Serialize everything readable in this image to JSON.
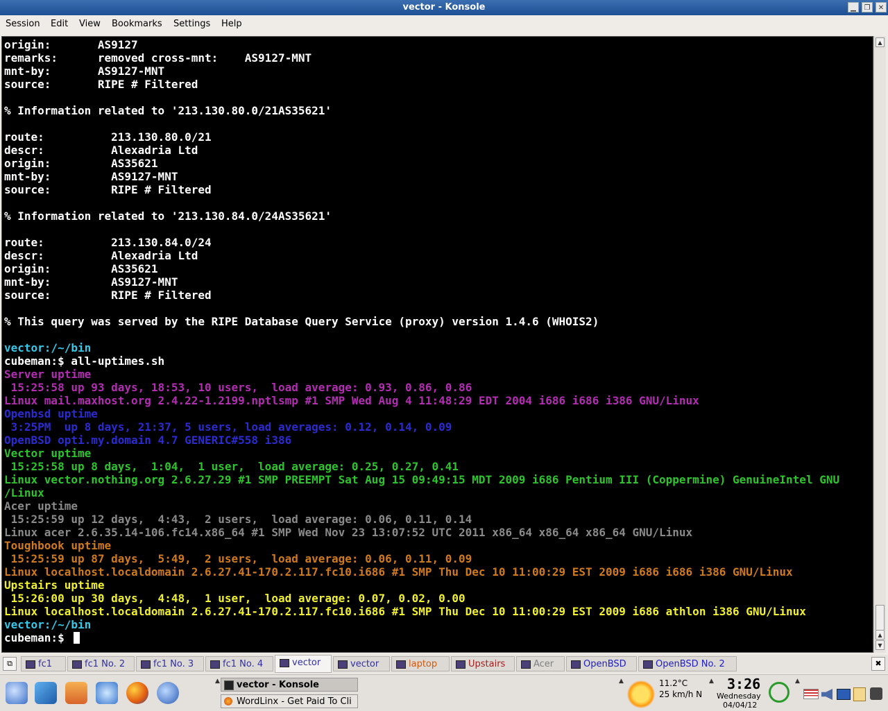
{
  "window": {
    "title": "vector - Konsole"
  },
  "menu": [
    "Session",
    "Edit",
    "View",
    "Bookmarks",
    "Settings",
    "Help"
  ],
  "terminal_lines": [
    {
      "text": "origin:       AS9127",
      "color": "#ffffff"
    },
    {
      "text": "remarks:      removed cross-mnt:    AS9127-MNT",
      "color": "#ffffff"
    },
    {
      "text": "mnt-by:       AS9127-MNT",
      "color": "#ffffff"
    },
    {
      "text": "source:       RIPE # Filtered",
      "color": "#ffffff"
    },
    {
      "text": "",
      "color": "#ffffff"
    },
    {
      "text": "% Information related to '213.130.80.0/21AS35621'",
      "color": "#ffffff"
    },
    {
      "text": "",
      "color": "#ffffff"
    },
    {
      "text": "route:          213.130.80.0/21",
      "color": "#ffffff"
    },
    {
      "text": "descr:          Alexadria Ltd",
      "color": "#ffffff"
    },
    {
      "text": "origin:         AS35621",
      "color": "#ffffff"
    },
    {
      "text": "mnt-by:         AS9127-MNT",
      "color": "#ffffff"
    },
    {
      "text": "source:         RIPE # Filtered",
      "color": "#ffffff"
    },
    {
      "text": "",
      "color": "#ffffff"
    },
    {
      "text": "% Information related to '213.130.84.0/24AS35621'",
      "color": "#ffffff"
    },
    {
      "text": "",
      "color": "#ffffff"
    },
    {
      "text": "route:          213.130.84.0/24",
      "color": "#ffffff"
    },
    {
      "text": "descr:          Alexadria Ltd",
      "color": "#ffffff"
    },
    {
      "text": "origin:         AS35621",
      "color": "#ffffff"
    },
    {
      "text": "mnt-by:         AS9127-MNT",
      "color": "#ffffff"
    },
    {
      "text": "source:         RIPE # Filtered",
      "color": "#ffffff"
    },
    {
      "text": "",
      "color": "#ffffff"
    },
    {
      "text": "% This query was served by the RIPE Database Query Service (proxy) version 1.4.6 (WHOIS2)",
      "color": "#ffffff"
    },
    {
      "text": "",
      "color": "#ffffff"
    },
    {
      "text": "vector:/~/bin",
      "color": "#37c8e8"
    },
    {
      "text": "cubeman:$ all-uptimes.sh",
      "color": "#ffffff"
    },
    {
      "text": "Server uptime",
      "color": "#b22db2"
    },
    {
      "text": " 15:25:58 up 93 days, 18:53, 10 users,  load average: 0.93, 0.86, 0.86",
      "color": "#b22db2"
    },
    {
      "text": "Linux mail.maxhost.org 2.4.22-1.2199.nptlsmp #1 SMP Wed Aug 4 11:48:29 EDT 2004 i686 i686 i386 GNU/Linux",
      "color": "#b22db2"
    },
    {
      "text": "Openbsd uptime",
      "color": "#2b2bd0"
    },
    {
      "text": " 3:25PM  up 8 days, 21:37, 5 users, load averages: 0.12, 0.14, 0.09",
      "color": "#2b2bd0"
    },
    {
      "text": "OpenBSD opti.my.domain 4.7 GENERIC#558 i386",
      "color": "#2b2bd0"
    },
    {
      "text": "Vector uptime",
      "color": "#2ec42e"
    },
    {
      "text": " 15:25:58 up 8 days,  1:04,  1 user,  load average: 0.25, 0.27, 0.41",
      "color": "#2ec42e"
    },
    {
      "text": "Linux vector.nothing.org 2.6.27.29 #1 SMP PREEMPT Sat Aug 15 09:49:15 MDT 2009 i686 Pentium III (Coppermine) GenuineIntel GNU",
      "color": "#2ec42e"
    },
    {
      "text": "/Linux",
      "color": "#2ec42e"
    },
    {
      "text": "Acer uptime",
      "color": "#8a8a8a"
    },
    {
      "text": " 15:25:59 up 12 days,  4:43,  2 users,  load average: 0.06, 0.11, 0.14",
      "color": "#8a8a8a"
    },
    {
      "text": "Linux acer 2.6.35.14-106.fc14.x86_64 #1 SMP Wed Nov 23 13:07:52 UTC 2011 x86_64 x86_64 x86_64 GNU/Linux",
      "color": "#8a8a8a"
    },
    {
      "text": "Toughbook uptime",
      "color": "#d07a1e"
    },
    {
      "text": " 15:25:59 up 87 days,  5:49,  2 users,  load average: 0.06, 0.11, 0.09",
      "color": "#d07a1e"
    },
    {
      "text": "Linux localhost.localdomain 2.6.27.41-170.2.117.fc10.i686 #1 SMP Thu Dec 10 11:00:29 EST 2009 i686 i686 i386 GNU/Linux",
      "color": "#d07a1e"
    },
    {
      "text": "Upstairs uptime",
      "color": "#f0f030"
    },
    {
      "text": " 15:26:00 up 30 days,  4:48,  1 user,  load average: 0.07, 0.02, 0.00",
      "color": "#f0f030"
    },
    {
      "text": "Linux localhost.localdomain 2.6.27.41-170.2.117.fc10.i686 #1 SMP Thu Dec 10 11:00:29 EST 2009 i686 athlon i386 GNU/Linux",
      "color": "#f0f030"
    },
    {
      "text": "vector:/~/bin",
      "color": "#37c8e8"
    },
    {
      "text": "cubeman:$ ",
      "color": "#ffffff"
    }
  ],
  "tabs": [
    {
      "label": "fc1",
      "color": "#3030a0"
    },
    {
      "label": "fc1 No. 2",
      "color": "#3030a0"
    },
    {
      "label": "fc1 No. 3",
      "color": "#3030a0"
    },
    {
      "label": "fc1 No. 4",
      "color": "#3030a0"
    },
    {
      "label": "vector",
      "color": "#3030a0"
    },
    {
      "label": "vector",
      "color": "#3030a0"
    },
    {
      "label": "laptop",
      "color": "#d05a10"
    },
    {
      "label": "Upstairs",
      "color": "#a02020"
    },
    {
      "label": "Acer",
      "color": "#808080"
    },
    {
      "label": "OpenBSD",
      "color": "#2020c0"
    },
    {
      "label": "OpenBSD No. 2",
      "color": "#2020c0"
    }
  ],
  "taskbar": {
    "tasks": [
      "vector - Konsole",
      "WordLinx - Get Paid To Cli"
    ],
    "weather": {
      "temp": "11.2°C",
      "wind": "25 km/h N"
    },
    "clock": {
      "time": "3:26",
      "day": "Wednesday",
      "date": "04/04/12"
    }
  }
}
